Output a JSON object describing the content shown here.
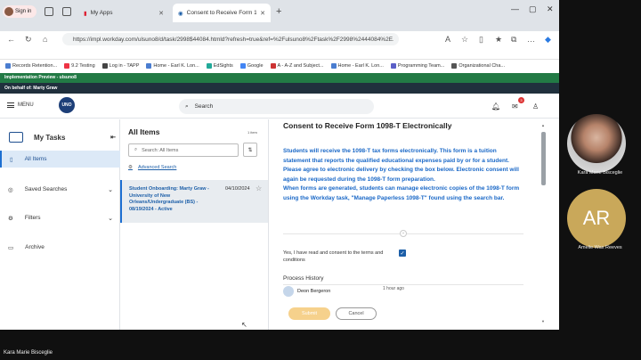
{
  "browser": {
    "profile_label": "Sign in",
    "tabs": [
      {
        "title": "My Apps"
      },
      {
        "title": "Consent to Receive Form 1098-T"
      }
    ],
    "url": "https://impl.workday.com/ulsuno8/d/task/2998$44084.htmld?refresh=true&ref=%2Fulsuno8%2Ftask%2F2998%2444084%2E...",
    "bookmarks": [
      "Records Retention...",
      "9.2 Testing",
      "Log in - TAPP",
      "Home - Earl K. Lon...",
      "EdSights",
      "Google",
      "A - A-Z and Subject...",
      "Home - Earl K. Lon...",
      "Programming Team...",
      "Organizational Cha..."
    ]
  },
  "banner": {
    "implementation": "Implementation Preview - ulsuno8",
    "on_behalf": "On behalf of: Marty Graw"
  },
  "header": {
    "menu_label": "MENU",
    "logo_text": "UNO",
    "search_placeholder": "Search",
    "inbox_badge": "3"
  },
  "sidebar": {
    "title": "My Tasks",
    "items": [
      {
        "label": "All Items"
      },
      {
        "label": "Saved Searches"
      },
      {
        "label": "Filters"
      },
      {
        "label": "Archive"
      }
    ]
  },
  "list": {
    "title": "All Items",
    "count": "1 item",
    "search_placeholder": "Search: All Items",
    "advanced_search": "Advanced Search",
    "card": {
      "title": "Student Onboarding: Marty Graw - University of New Orleans/Undergraduate (BS) - 08/19/2024 - Active",
      "date": "04/10/2024"
    }
  },
  "task": {
    "title": "Consent to Receive Form 1098-T Electronically",
    "message": "Students will receive the 1098-T tax forms electronically. This form is a tuition statement that reports the qualified educational expenses paid by or for a student.\nPlease agree to electronic delivery by checking the box below. Electronic consent will again be requested during the 1098-T form preparation.\nWhen forms are generated, students can manage electronic copies of the 1098-T form using the Workday task, \"Manage Paperless 1098-T\" found using the search bar.",
    "consent_label": "Yes, I have read and consent to the terms and conditions",
    "consent_checked": true,
    "process_history": "Process History",
    "history_user": "Deon Bergeron",
    "history_time": "1 hour ago",
    "submit_label": "Submit",
    "cancel_label": "Cancel"
  },
  "meeting": {
    "participants": [
      {
        "name": "Kara Marie Bisceglie"
      },
      {
        "name": "Amelie Wax Reeves",
        "initials": "AR"
      }
    ],
    "presenter": "Kara Marie Bisceglie"
  }
}
